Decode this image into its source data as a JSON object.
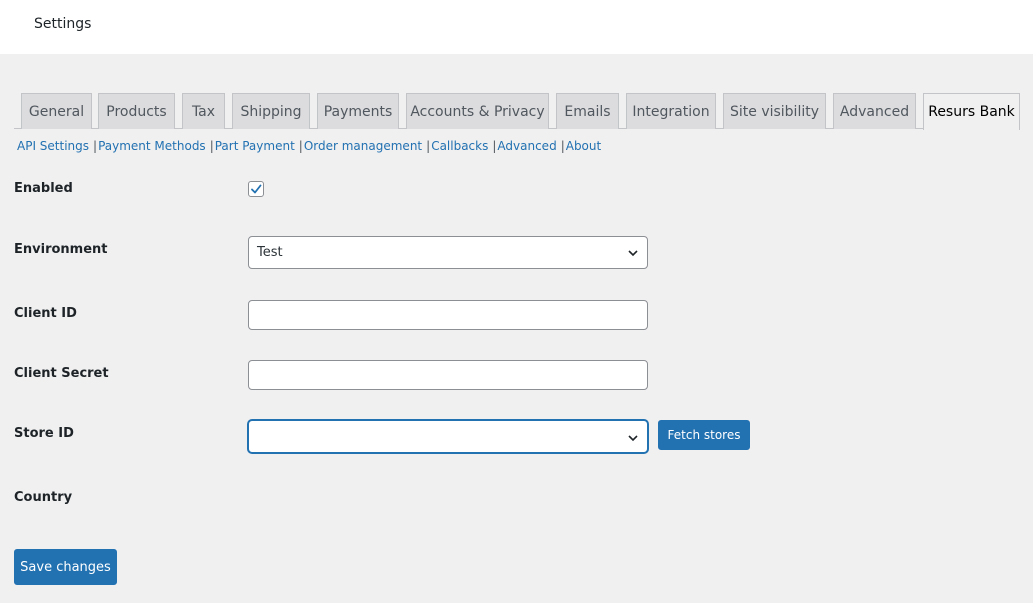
{
  "header": {
    "title": "Settings"
  },
  "tabs": [
    {
      "label": "General",
      "active": false
    },
    {
      "label": "Products",
      "active": false
    },
    {
      "label": "Tax",
      "active": false
    },
    {
      "label": "Shipping",
      "active": false
    },
    {
      "label": "Payments",
      "active": false
    },
    {
      "label": "Accounts & Privacy",
      "active": false
    },
    {
      "label": "Emails",
      "active": false
    },
    {
      "label": "Integration",
      "active": false
    },
    {
      "label": "Site visibility",
      "active": false
    },
    {
      "label": "Advanced",
      "active": false
    },
    {
      "label": "Resurs Bank",
      "active": true
    }
  ],
  "subnav": [
    {
      "label": "API Settings"
    },
    {
      "label": "Payment Methods"
    },
    {
      "label": "Part Payment"
    },
    {
      "label": "Order management"
    },
    {
      "label": "Callbacks"
    },
    {
      "label": "Advanced"
    },
    {
      "label": "About"
    }
  ],
  "form": {
    "enabled": {
      "label": "Enabled",
      "checked": true
    },
    "environment": {
      "label": "Environment",
      "value": "Test"
    },
    "client_id": {
      "label": "Client ID",
      "value": ""
    },
    "client_secret": {
      "label": "Client Secret",
      "value": ""
    },
    "store_id": {
      "label": "Store ID",
      "value": ""
    },
    "fetch_stores_label": "Fetch stores",
    "country": {
      "label": "Country"
    }
  },
  "save_label": "Save changes",
  "colors": {
    "accent": "#2271b1",
    "background": "#f0f0f1",
    "tab_inactive": "#dcdcde"
  }
}
